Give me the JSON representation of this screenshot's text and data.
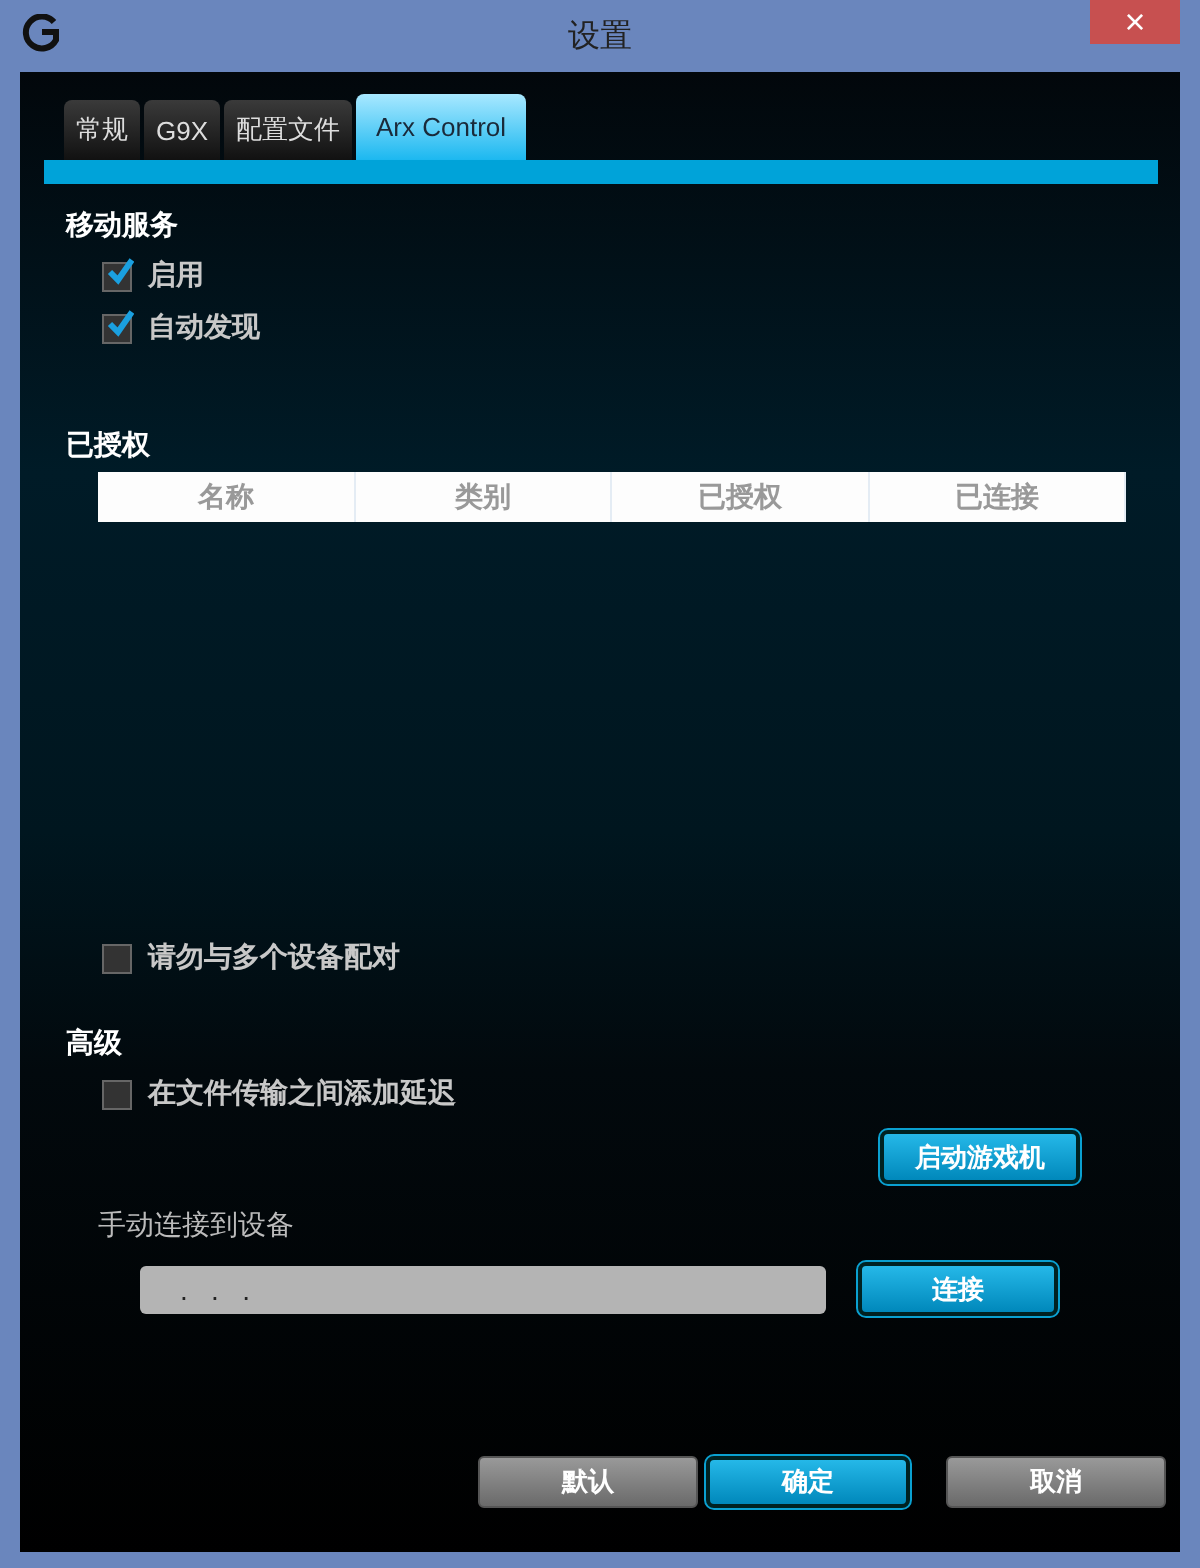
{
  "window": {
    "title": "设置",
    "close": "×"
  },
  "tabs": [
    {
      "label": "常规",
      "selected": false
    },
    {
      "label": "G9X",
      "selected": false
    },
    {
      "label": "配置文件",
      "selected": false
    },
    {
      "label": "Arx Control",
      "selected": true
    }
  ],
  "mobile_service": {
    "heading": "移动服务",
    "options": [
      {
        "label": "启用",
        "checked": true
      },
      {
        "label": "自动发现",
        "checked": true
      }
    ]
  },
  "authorized": {
    "heading": "已授权",
    "columns": [
      "名称",
      "类别",
      "已授权",
      "已连接"
    ]
  },
  "pair_option": {
    "label": "请勿与多个设备配对",
    "checked": false
  },
  "advanced": {
    "heading": "高级",
    "options": [
      {
        "label": "在文件传输之间添加延迟",
        "checked": false
      }
    ],
    "launch_button": "启动游戏机"
  },
  "manual_connect": {
    "label": "手动连接到设备",
    "ip_field": {
      "value": ".   .   ."
    },
    "connect_button": "连接"
  },
  "buttons": [
    {
      "label": "默认",
      "kind": "plain"
    },
    {
      "label": "确定",
      "kind": "primary"
    },
    {
      "label": "取消",
      "kind": "plain"
    }
  ]
}
